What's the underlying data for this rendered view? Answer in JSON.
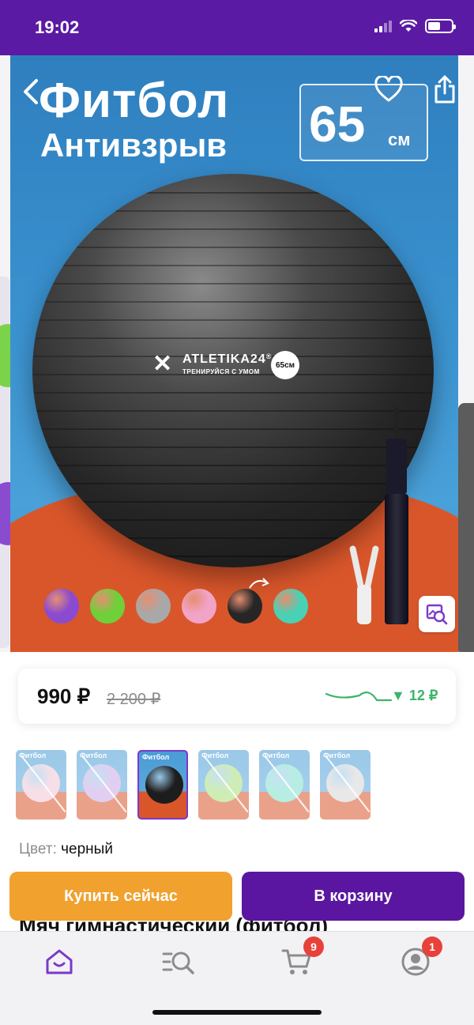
{
  "status_bar": {
    "time": "19:02"
  },
  "hero": {
    "title": "Фитбол",
    "subtitle": "Антивзрыв",
    "size_value": "65",
    "size_unit": "см",
    "brand": "ATLETIKA24",
    "brand_mark": "®",
    "tagline": "ТРЕНИРУЙСЯ С УМОМ",
    "badge": "65см",
    "colors": {
      "background": "#3a92cf",
      "floor": "#d9562b",
      "ball": "#262626"
    }
  },
  "price": {
    "current": "990 ₽",
    "old": "2 200 ₽",
    "drop": "▼ 12 ₽",
    "trend_color": "#3bb56a"
  },
  "thumbnails": [
    {
      "label": "Фитбол",
      "color": "#f2c6d6",
      "active": false
    },
    {
      "label": "Фитбол",
      "color": "#c9a8e6",
      "active": false
    },
    {
      "label": "Фитбол",
      "color": "#1d1d1d",
      "active": true
    },
    {
      "label": "Фитбол",
      "color": "#a6e07a",
      "active": false
    },
    {
      "label": "Фитбол",
      "color": "#7fe0cf",
      "active": false
    },
    {
      "label": "Фитбол",
      "color": "#d6d6d6",
      "active": false
    }
  ],
  "color_option": {
    "label": "Цвет:",
    "value": "черный"
  },
  "product_title": "Мяч гимнастический (фитбол)",
  "actions": {
    "buy_now": "Купить сейчас",
    "add_to_cart": "В корзину"
  },
  "tabbar": {
    "items": [
      {
        "name": "home",
        "icon": "home-icon",
        "active": true
      },
      {
        "name": "catalog",
        "icon": "catalog-search-icon",
        "active": false
      },
      {
        "name": "cart",
        "icon": "cart-icon",
        "badge": "9"
      },
      {
        "name": "profile",
        "icon": "profile-icon",
        "badge": "1"
      }
    ],
    "accent": "#7b39c9"
  },
  "mini_balls": [
    "#8a4bd1",
    "#6fd03a",
    "#a8a8a8",
    "#f2a3c8",
    "#262626",
    "#49d1b5"
  ]
}
